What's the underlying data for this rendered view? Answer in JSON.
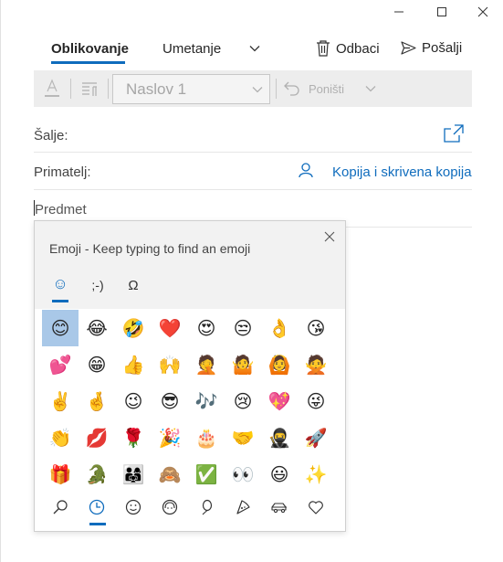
{
  "window": {
    "controls": [
      "minimize",
      "maximize",
      "close"
    ]
  },
  "tabs": [
    {
      "label": "Oblikovanje",
      "active": true
    },
    {
      "label": "Umetanje",
      "active": false
    }
  ],
  "commands": {
    "discard": "Odbaci",
    "send": "Pošalji"
  },
  "toolbar": {
    "style_value": "Naslov 1",
    "undo_label": "Poništi"
  },
  "fields": {
    "from_label": "Šalje:",
    "to_label": "Primatelj:",
    "cc_bcc_label": "Kopija i skrivena kopija",
    "subject_placeholder": "Predmet"
  },
  "emoji_panel": {
    "title": "Emoji - Keep typing to find an emoji",
    "category_tabs": [
      "☺",
      ";-)",
      "Ω"
    ],
    "emojis": [
      "😊",
      "😂",
      "🤣",
      "❤️",
      "😍",
      "😒",
      "👌",
      "😘",
      "💕",
      "😁",
      "👍",
      "🙌",
      "🤦",
      "🤷",
      "🙆",
      "🙅",
      "✌️",
      "🤞",
      "😉",
      "😎",
      "🎶",
      "😢",
      "💖",
      "😜",
      "👏",
      "💋",
      "🌹",
      "🎉",
      "🎂",
      "🤝",
      "🥷",
      "🚀",
      "🎁",
      "🐊",
      "👨‍👩‍👧",
      "🙈",
      "✅",
      "👀",
      "😃",
      "✨"
    ],
    "selected_index": 0,
    "bottom_categories": [
      "search-icon",
      "recent-icon",
      "smiley-icon",
      "people-icon",
      "balloon-icon",
      "pizza-icon",
      "car-icon",
      "heart-icon"
    ],
    "bottom_active_index": 1
  },
  "colors": {
    "accent": "#0f6cbd",
    "link": "#0f6cbd"
  }
}
